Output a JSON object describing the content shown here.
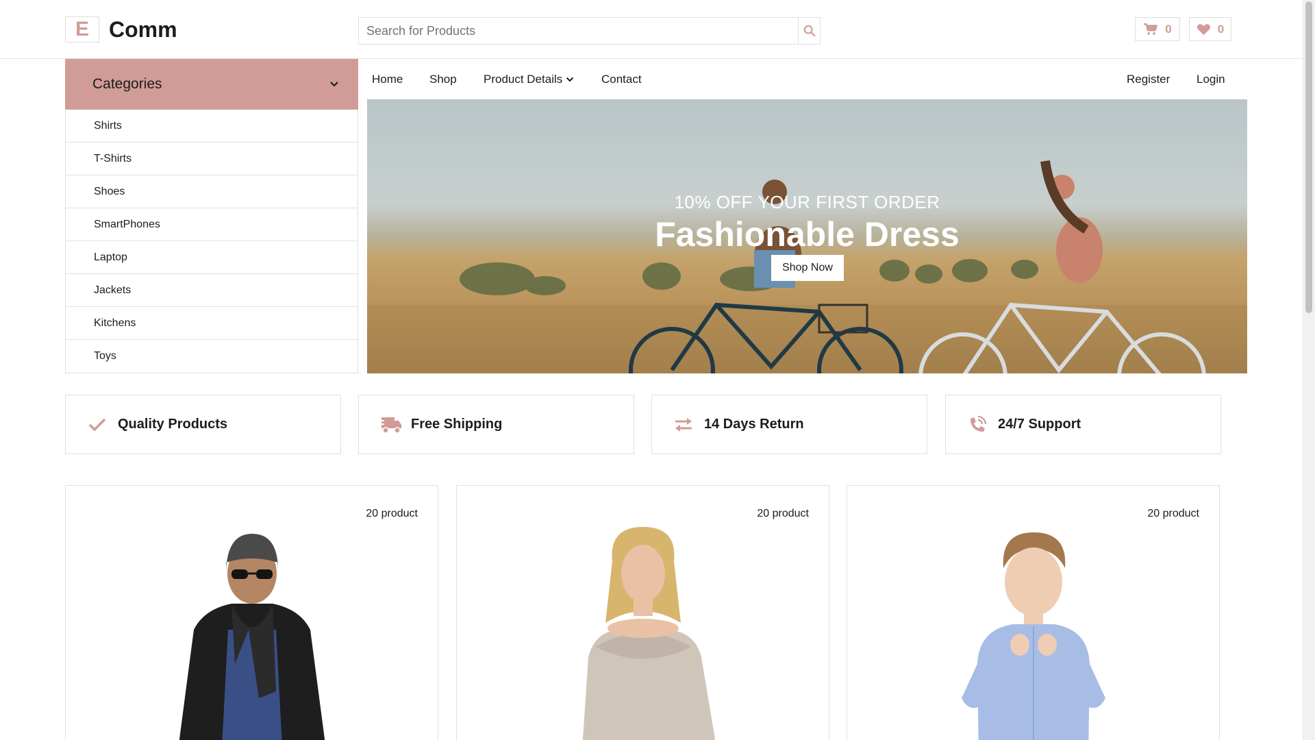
{
  "header": {
    "logo_letter": "E",
    "logo_text": "Comm",
    "search_placeholder": "Search for Products",
    "cart_count": "0",
    "wishlist_count": "0",
    "accent_color": "#D19C97"
  },
  "categories": {
    "title": "Categories",
    "items": [
      "Shirts",
      "T-Shirts",
      "Shoes",
      "SmartPhones",
      "Laptop",
      "Jackets",
      "Kitchens",
      "Toys"
    ]
  },
  "nav": {
    "home": "Home",
    "shop": "Shop",
    "product_details": "Product Details",
    "contact": "Contact",
    "register": "Register",
    "login": "Login"
  },
  "hero": {
    "subtitle": "10% OFF YOUR FIRST ORDER",
    "title": "Fashionable Dress",
    "button": "Shop Now"
  },
  "features": [
    {
      "label": "Quality Products",
      "icon": "check-icon"
    },
    {
      "label": "Free Shipping",
      "icon": "shipping-truck-icon"
    },
    {
      "label": "14 Days Return",
      "icon": "exchange-arrows-icon"
    },
    {
      "label": "24/7 Support",
      "icon": "phone-volume-icon"
    }
  ],
  "products": [
    {
      "count": "20 product",
      "image": "man-in-jacket"
    },
    {
      "count": "20 product",
      "image": "woman-in-sweater"
    },
    {
      "count": "20 product",
      "image": "boy-in-shirt"
    }
  ]
}
